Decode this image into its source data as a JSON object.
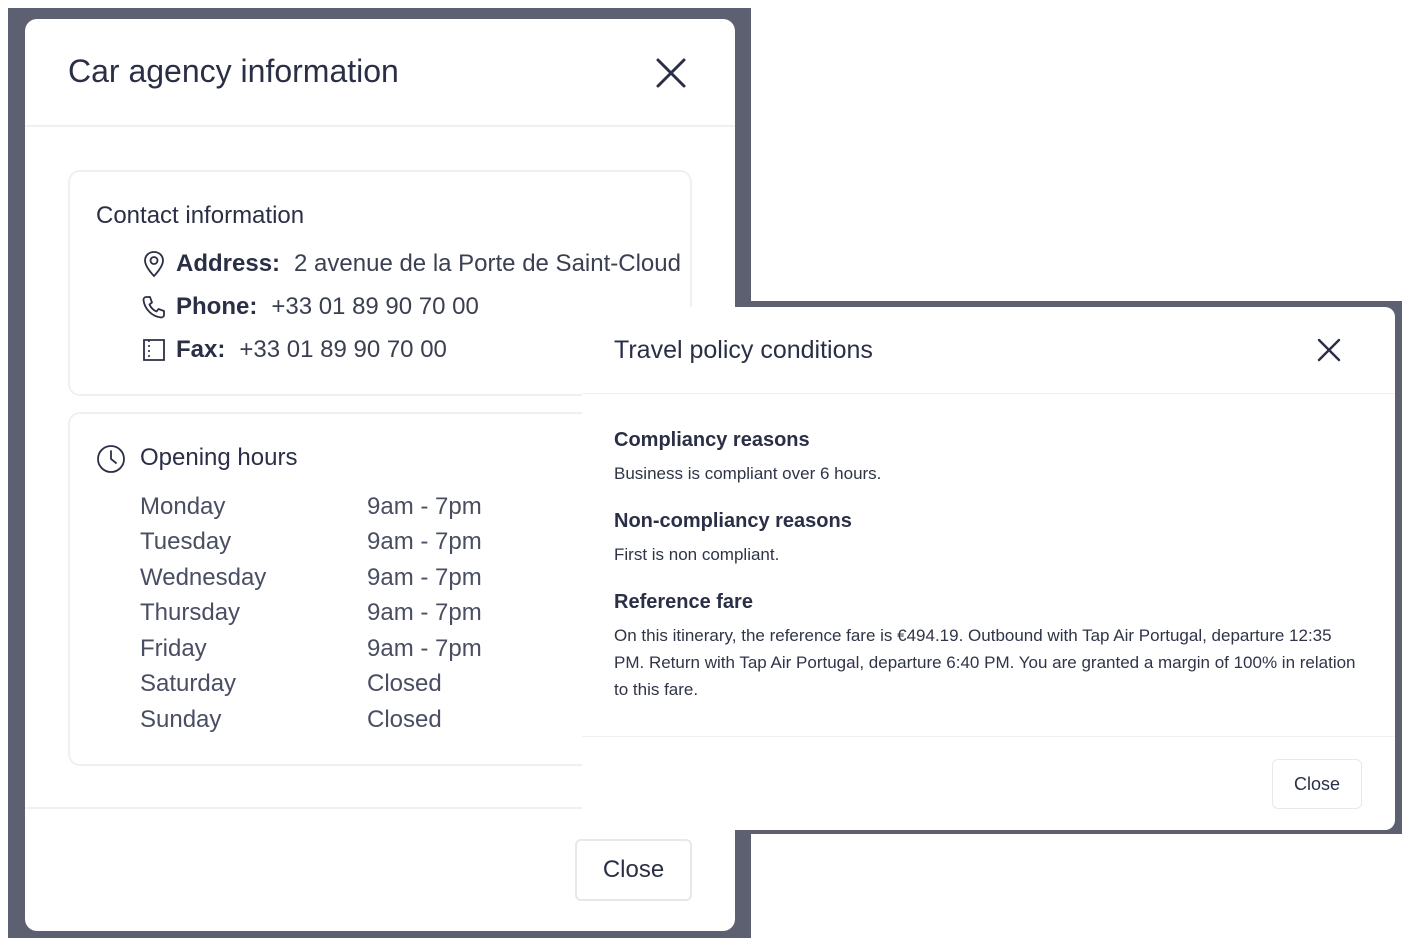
{
  "car_agency_modal": {
    "title": "Car agency information",
    "contact": {
      "heading": "Contact information",
      "address_label": "Address:",
      "address_value": "2 avenue de la Porte de Saint-Cloud",
      "phone_label": "Phone:",
      "phone_value": "+33 01 89 90 70 00",
      "fax_label": "Fax:",
      "fax_value": "+33 01 89 90 70 00"
    },
    "hours": {
      "heading": "Opening hours",
      "rows": [
        {
          "day": "Monday",
          "time": "9am - 7pm"
        },
        {
          "day": "Tuesday",
          "time": "9am - 7pm"
        },
        {
          "day": "Wednesday",
          "time": "9am - 7pm"
        },
        {
          "day": "Thursday",
          "time": "9am - 7pm"
        },
        {
          "day": "Friday",
          "time": "9am - 7pm"
        },
        {
          "day": "Saturday",
          "time": "Closed"
        },
        {
          "day": "Sunday",
          "time": "Closed"
        }
      ]
    },
    "close_label": "Close"
  },
  "travel_policy_modal": {
    "title": "Travel policy conditions",
    "sections": [
      {
        "heading": "Compliancy reasons",
        "text": "Business is compliant over 6 hours."
      },
      {
        "heading": "Non-compliancy reasons",
        "text": "First is non compliant."
      },
      {
        "heading": "Reference fare",
        "text": "On this itinerary, the reference fare is €494.19. Outbound with Tap Air Portugal, departure 12:35 PM. Return with Tap Air Portugal, departure 6:40 PM. You are granted a margin of 100% in relation to this fare."
      }
    ],
    "close_label": "Close"
  },
  "colors": {
    "backdrop": "#5d6070",
    "text": "#2a2f45",
    "divider": "#eef0f3"
  }
}
